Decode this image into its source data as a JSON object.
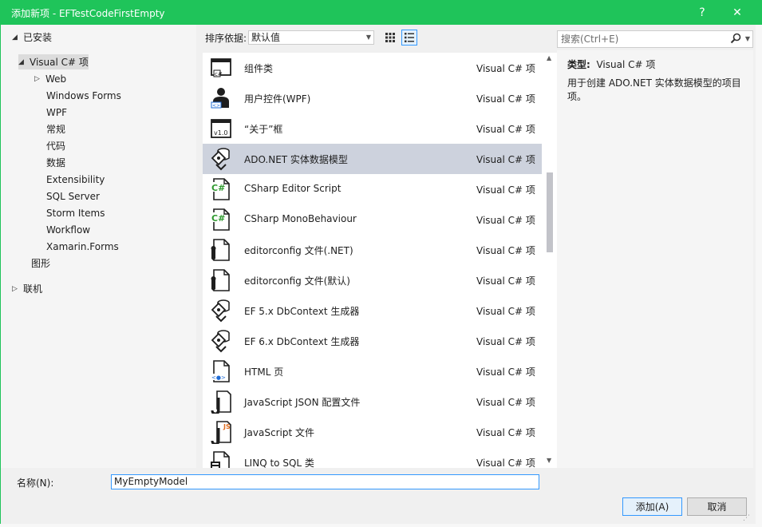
{
  "window": {
    "title": "添加新项 - EFTestCodeFirstEmpty",
    "help": "?",
    "close": "✕"
  },
  "nav": {
    "installed": "已安装",
    "visual_csharp": "Visual C# 项",
    "children": [
      "Web",
      "Windows Forms",
      "WPF",
      "常规",
      "代码",
      "数据",
      "Extensibility",
      "SQL Server",
      "Storm Items",
      "Workflow",
      "Xamarin.Forms"
    ],
    "graphics": "图形",
    "online": "联机"
  },
  "sortbar": {
    "label": "排序依据:",
    "value": "默认值"
  },
  "items": [
    {
      "name": "组件类",
      "type": "Visual C# 项",
      "icon": "component-class-icon"
    },
    {
      "name": "用户控件(WPF)",
      "type": "Visual C# 项",
      "icon": "user-control-icon"
    },
    {
      "name": "“关于”框",
      "type": "Visual C# 项",
      "icon": "about-box-icon"
    },
    {
      "name": "ADO.NET 实体数据模型",
      "type": "Visual C# 项",
      "icon": "entity-model-icon"
    },
    {
      "name": "CSharp Editor Script",
      "type": "Visual C# 项",
      "icon": "csharp-file-icon"
    },
    {
      "name": "CSharp MonoBehaviour",
      "type": "Visual C# 项",
      "icon": "csharp-file-icon"
    },
    {
      "name": "editorconfig 文件(.NET)",
      "type": "Visual C# 项",
      "icon": "config-file-icon"
    },
    {
      "name": "editorconfig 文件(默认)",
      "type": "Visual C# 项",
      "icon": "config-file-icon"
    },
    {
      "name": "EF 5.x DbContext 生成器",
      "type": "Visual C# 项",
      "icon": "dbcontext-generator-icon"
    },
    {
      "name": "EF 6.x DbContext 生成器",
      "type": "Visual C# 项",
      "icon": "dbcontext-generator-icon"
    },
    {
      "name": "HTML 页",
      "type": "Visual C# 项",
      "icon": "html-page-icon"
    },
    {
      "name": "JavaScript JSON 配置文件",
      "type": "Visual C# 项",
      "icon": "json-config-icon"
    },
    {
      "name": "JavaScript 文件",
      "type": "Visual C# 项",
      "icon": "javascript-file-icon"
    },
    {
      "name": "LINQ to SQL 类",
      "type": "Visual C# 项",
      "icon": "linq-sql-icon"
    }
  ],
  "selected_index": 3,
  "search": {
    "placeholder": "搜索(Ctrl+E)"
  },
  "details": {
    "type_label": "类型:",
    "type_value": "Visual C# 项",
    "description": "用于创建 ADO.NET 实体数据模型的项目项。"
  },
  "name_field": {
    "label": "名称(N):",
    "value": "MyEmptyModel"
  },
  "buttons": {
    "add": "添加(A)",
    "cancel": "取消"
  },
  "colors": {
    "titlebar": "#1fc45a",
    "selection": "#cdd2dd",
    "accent": "#3399ff"
  }
}
